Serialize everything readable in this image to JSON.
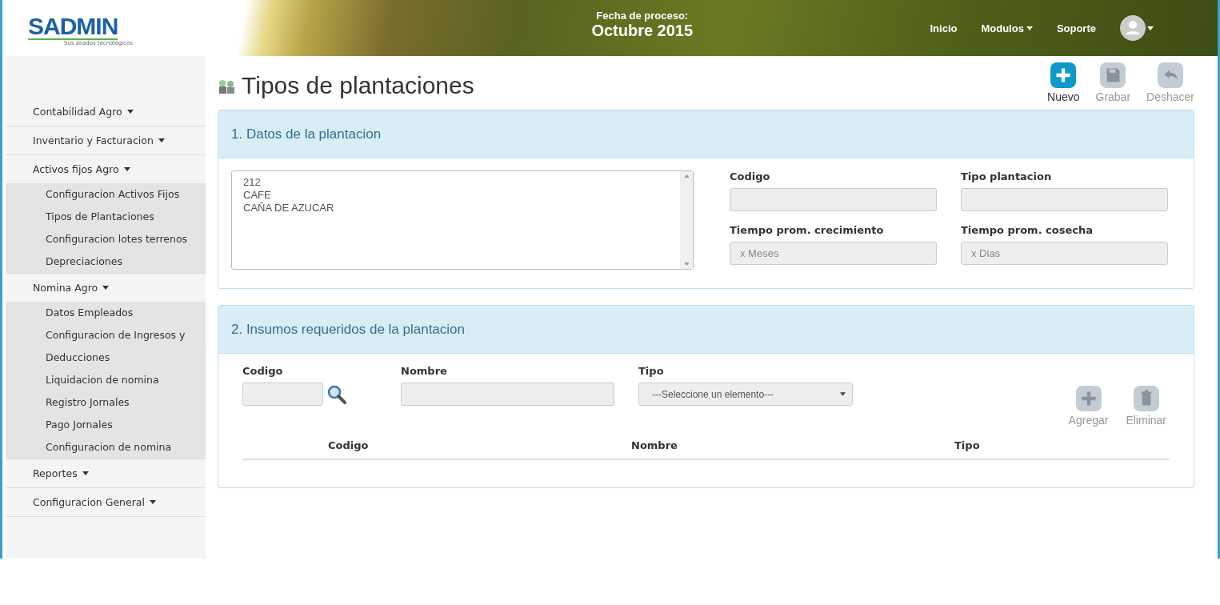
{
  "header": {
    "logo": {
      "name": "SADMIN",
      "tagline": "Sus aliados tecnológicos"
    },
    "process_date": {
      "label": "Fecha de proceso:",
      "value": "Octubre 2015"
    },
    "nav": [
      {
        "label": "Inicio",
        "kind": "link"
      },
      {
        "label": "Modulos",
        "kind": "dropdown"
      },
      {
        "label": "Soporte",
        "kind": "link"
      }
    ]
  },
  "sidebar": {
    "items": [
      {
        "label": "Contabilidad Agro",
        "expanded": false
      },
      {
        "label": "Inventario y Facturacion",
        "expanded": false
      },
      {
        "label": "Activos fijos Agro",
        "expanded": true,
        "children": [
          {
            "label": "Configuracion Activos Fijos"
          },
          {
            "label": "Tipos de Plantaciones"
          },
          {
            "label": "Configuracion lotes terrenos"
          },
          {
            "label": "Depreciaciones"
          }
        ]
      },
      {
        "label": "Nomina Agro",
        "expanded": true,
        "children": [
          {
            "label": "Datos Empleados"
          },
          {
            "label": "Configuracion de Ingresos y"
          },
          {
            "label": "Deducciones"
          },
          {
            "label": "Liquidacion de nomina"
          },
          {
            "label": "Registro Jornales"
          },
          {
            "label": "Pago Jornales"
          },
          {
            "label": "Configuracion de nomina"
          }
        ]
      },
      {
        "label": "Reportes",
        "expanded": false
      },
      {
        "label": "Configuracion General",
        "expanded": false
      }
    ]
  },
  "page_title": "Tipos de plantaciones",
  "toolbar": [
    {
      "label": "Nuevo",
      "kind": "new",
      "disabled": false
    },
    {
      "label": "Grabar",
      "kind": "save",
      "disabled": true
    },
    {
      "label": "Deshacer",
      "kind": "undo",
      "disabled": true
    }
  ],
  "section_1": {
    "title": "1. Datos de la plantacion",
    "list_items": [
      "212",
      "CAFE",
      "CAÑA DE AZUCAR"
    ],
    "fields": [
      {
        "label": "Codigo"
      },
      {
        "label": "Tipo plantacion"
      },
      {
        "label": "Tiempo prom. crecimiento",
        "placeholder": "x Meses"
      },
      {
        "label": "Tiempo prom. cosecha",
        "placeholder": "x Dias"
      }
    ]
  },
  "section_2": {
    "title": "2. Insumos requeridos de la plantacion",
    "fields": [
      {
        "label": "Codigo",
        "kind": "search"
      },
      {
        "label": "Nombre",
        "kind": "text"
      },
      {
        "label": "Tipo",
        "kind": "select",
        "value": "---Seleccione un elemento---"
      }
    ],
    "actions": [
      {
        "label": "Agregar",
        "kind": "add",
        "disabled": true
      },
      {
        "label": "Eliminar",
        "kind": "delete",
        "disabled": true
      }
    ],
    "table": {
      "columns": [
        "Codigo",
        "Nombre",
        "Tipo"
      ]
    }
  }
}
